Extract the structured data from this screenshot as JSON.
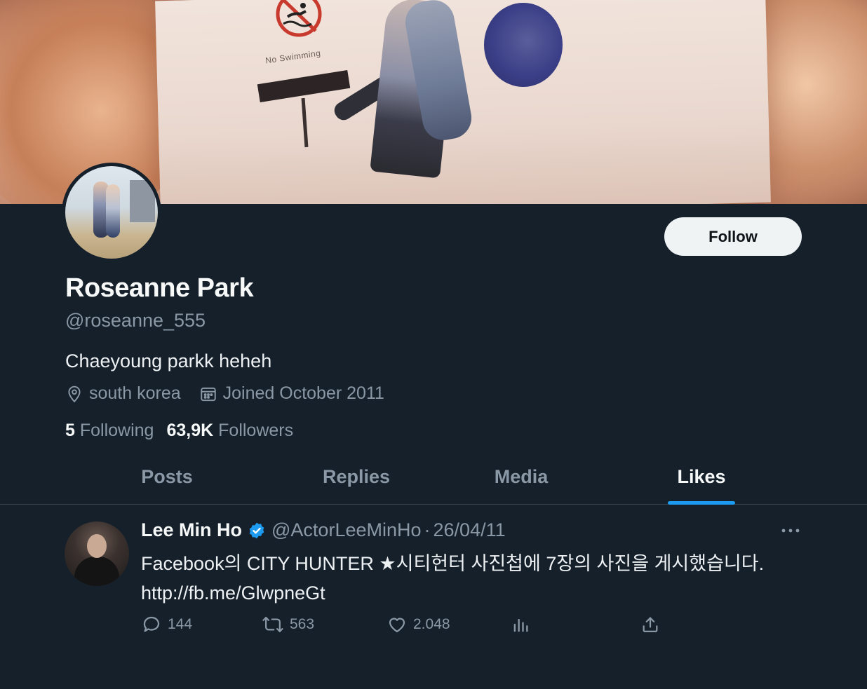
{
  "banner": {
    "sign_text": "No Swimming"
  },
  "profile": {
    "name": "Roseanne Park",
    "handle": "@roseanne_555",
    "bio": "Chaeyoung parkk heheh",
    "location": "south korea",
    "joined": "Joined October 2011",
    "following_count": "5",
    "following_label": "Following",
    "followers_count": "63,9K",
    "followers_label": "Followers",
    "follow_button": "Follow"
  },
  "tabs": [
    {
      "label": "Posts",
      "active": false
    },
    {
      "label": "Replies",
      "active": false
    },
    {
      "label": "Media",
      "active": false
    },
    {
      "label": "Likes",
      "active": true
    }
  ],
  "tweet": {
    "name": "Lee Min Ho",
    "verified": true,
    "handle": "@ActorLeeMinHo",
    "separator": "·",
    "date": "26/04/11",
    "text_line1": "Facebook의 CITY HUNTER ★시티헌터 사진첩에 7장의 사진을 게시했습니다.",
    "text_link": "http://fb.me/GlwpneGt",
    "replies": "144",
    "reposts": "563",
    "likes": "2.048"
  },
  "icons": {
    "location": "location-pin-icon",
    "calendar": "calendar-icon",
    "verified": "verified-badge-icon",
    "more": "more-dots-icon",
    "reply": "reply-bubble-icon",
    "repost": "repost-icon",
    "like": "heart-icon",
    "views": "views-chart-icon",
    "share": "share-upload-icon"
  },
  "colors": {
    "background": "#15202b",
    "accent": "#1d9bf0",
    "muted_text": "#8b98a5",
    "primary_text": "#f7f9f9",
    "divider": "#38444d"
  }
}
